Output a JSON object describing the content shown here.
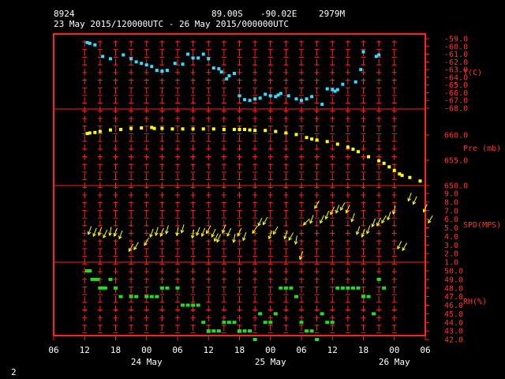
{
  "header": {
    "station": "8924",
    "lat": "89.00S",
    "lon": "-90.02E",
    "elev": "2979M",
    "period": "23 May 2015/120000UTC - 26 May 2015/000000UTC"
  },
  "page_number": "2",
  "colors": {
    "frame": "#ff2020",
    "axis_text": "#ffffff",
    "label_text": "#ff3030",
    "temperature": "#33ddff",
    "pressure": "#ffff00",
    "wind": "#ffff00",
    "rh": "#22dd22"
  },
  "chart_data": [
    {
      "type": "scatter",
      "panel": "temperature",
      "ylabel": "T(C)",
      "ylim": [
        -68,
        -59
      ],
      "yticks": [
        "-59.0",
        "-60.0",
        "-61.0",
        "-62.0",
        "-63.0",
        "-64.0",
        "-65.0",
        "-66.0",
        "-67.0",
        "-68.0"
      ],
      "x_hours": [
        12.5,
        13,
        14,
        15.5,
        17,
        19.5,
        21,
        22,
        23,
        24,
        25,
        26,
        27,
        28,
        29.5,
        31,
        32,
        33,
        34,
        35,
        36,
        37,
        38,
        38.5,
        39.5,
        40,
        41,
        42,
        43,
        44,
        45,
        46,
        47,
        48,
        49,
        49.5,
        50,
        51.5,
        53,
        54,
        55,
        56,
        58,
        59,
        60,
        60.5,
        61,
        62,
        64.5,
        65.5,
        66,
        68.5,
        69
      ],
      "values": [
        -59.5,
        -59.6,
        -59.8,
        -61.3,
        -61.6,
        -61.1,
        -61.6,
        -62.0,
        -62.2,
        -62.4,
        -62.6,
        -63.1,
        -63.2,
        -63.1,
        -62.2,
        -62.3,
        -61.0,
        -61.5,
        -61.5,
        -61.0,
        -61.6,
        -62.8,
        -62.9,
        -63.3,
        -64.2,
        -63.8,
        -63.5,
        -66.4,
        -66.9,
        -67.0,
        -66.8,
        -66.7,
        -66.2,
        -66.4,
        -66.5,
        -66.3,
        -66.1,
        -66.4,
        -66.8,
        -67.0,
        -66.8,
        -66.5,
        -67.5,
        -65.5,
        -65.6,
        -65.8,
        -65.6,
        -64.9,
        -64.6,
        -63.0,
        -60.7,
        -61.3,
        -61.1,
        -60.5,
        -61.0,
        -64.8
      ]
    },
    {
      "type": "scatter",
      "panel": "pressure",
      "ylabel": "Pre (mb)",
      "yrange": [
        649.5,
        665.5
      ],
      "yticks": [
        "660.0",
        "655.0",
        "650.0"
      ],
      "x_hours": [
        12.5,
        13,
        14,
        15,
        17,
        19,
        21,
        23,
        25,
        25.5,
        27,
        29,
        31,
        33,
        35,
        37,
        39,
        41,
        42,
        43,
        44,
        45,
        47,
        49,
        51,
        53,
        55,
        56,
        57,
        59,
        61,
        63,
        64,
        65,
        67,
        69,
        70,
        71,
        72,
        73,
        73.5,
        75,
        77
      ],
      "values": [
        660.3,
        660.4,
        660.5,
        660.7,
        661.0,
        661.1,
        661.3,
        661.4,
        661.5,
        661.3,
        661.3,
        661.2,
        661.2,
        661.2,
        661.2,
        661.2,
        661.1,
        661.1,
        661.1,
        661.1,
        661.0,
        660.9,
        660.9,
        660.7,
        660.4,
        660.1,
        659.5,
        659.2,
        659.0,
        658.7,
        658.2,
        657.6,
        657.2,
        656.7,
        655.7,
        654.9,
        654.4,
        653.7,
        653.0,
        652.3,
        652.0,
        651.6,
        650.9
      ]
    },
    {
      "type": "scatter",
      "panel": "wind",
      "ylabel": "SPD(MPS)",
      "ylim": [
        1,
        9
      ],
      "yticks": [
        "9.0",
        "8.0",
        "7.0",
        "6.0",
        "5.0",
        "4.0",
        "3.0",
        "2.0",
        "1.0"
      ],
      "x_hours": [
        13,
        14,
        15,
        16,
        17,
        18,
        19,
        21,
        22,
        24,
        25,
        26,
        27,
        28,
        30,
        31,
        33,
        34,
        35,
        36,
        37,
        37.5,
        38,
        39,
        40,
        41,
        42,
        43,
        45,
        46,
        47,
        48,
        49,
        51,
        52,
        53,
        54,
        55,
        56,
        57,
        58,
        59,
        60,
        61,
        62,
        63,
        64,
        65,
        66,
        67,
        68,
        69,
        70,
        71,
        72,
        73,
        74,
        75,
        76,
        78,
        79
      ],
      "values": [
        4.7,
        4.5,
        4.6,
        4.3,
        4.6,
        4.5,
        4.2,
        2.7,
        2.9,
        3.4,
        4.4,
        4.6,
        4.5,
        4.8,
        4.6,
        4.9,
        4.3,
        4.6,
        4.5,
        4.8,
        4.4,
        3.9,
        3.8,
        4.9,
        4.5,
        3.8,
        4.5,
        4.0,
        4.8,
        5.7,
        5.8,
        4.2,
        4.7,
        4.2,
        4.0,
        3.6,
        1.8,
        5.7,
        6.0,
        7.7,
        6.0,
        6.5,
        7.0,
        7.2,
        7.5,
        7.2,
        6.2,
        4.7,
        4.4,
        4.8,
        5.6,
        5.7,
        6.0,
        6.4,
        7.1,
        3.0,
        2.8,
        8.6,
        8.2,
        7.3,
        6.0
      ]
    },
    {
      "type": "scatter",
      "panel": "rh",
      "ylabel": "RH(%)",
      "ylim": [
        42,
        51
      ],
      "yticks": [
        "50.0",
        "49.0",
        "48.0",
        "47.0",
        "46.0",
        "45.0",
        "44.0",
        "43.0",
        "42.0"
      ],
      "x_hours": [
        12.5,
        13,
        13.5,
        14,
        14.5,
        15,
        15.5,
        16,
        17,
        18,
        19,
        21,
        22,
        24,
        25,
        26,
        27,
        28,
        30,
        31,
        32,
        33,
        34,
        35,
        36,
        37,
        38,
        39,
        40,
        41,
        42,
        43,
        44,
        45,
        46,
        47,
        48,
        49,
        50,
        51,
        52,
        53,
        54,
        55,
        56,
        57,
        58,
        59,
        60,
        61,
        62,
        63,
        64,
        65,
        66,
        67,
        68,
        69,
        70
      ],
      "values": [
        50,
        50,
        49,
        49,
        49,
        48,
        48,
        48,
        49,
        48,
        47,
        47,
        47,
        47,
        47,
        47,
        48,
        48,
        48,
        46,
        46,
        46,
        46,
        44,
        43,
        43,
        43,
        44,
        44,
        44,
        43,
        43,
        43,
        42,
        45,
        44,
        44,
        45,
        48,
        48,
        48,
        47,
        44,
        43,
        43,
        42,
        45,
        44,
        44,
        48,
        48,
        48,
        48,
        48,
        47,
        47,
        45,
        49,
        48
      ]
    }
  ],
  "x_axis": {
    "ticks": [
      "06",
      "12",
      "18",
      "00",
      "06",
      "12",
      "18",
      "00",
      "06",
      "12",
      "18",
      "00",
      "06"
    ],
    "dates": [
      "24 May",
      "25 May",
      "26 May"
    ],
    "range_hours": [
      6,
      78
    ]
  },
  "wind_dirs_deg": [
    200,
    200,
    200,
    205,
    190,
    200,
    200,
    210,
    210,
    210,
    200,
    195,
    200,
    195,
    190,
    195,
    190,
    200,
    200,
    210,
    205,
    205,
    205,
    200,
    205,
    190,
    205,
    200,
    215,
    205,
    210,
    200,
    210,
    200,
    210,
    190,
    200,
    225,
    200,
    210,
    205,
    200,
    205,
    200,
    210,
    205,
    200,
    200,
    200,
    200,
    200,
    205,
    210,
    200,
    195,
    205,
    210,
    200,
    205,
    205,
    210
  ]
}
